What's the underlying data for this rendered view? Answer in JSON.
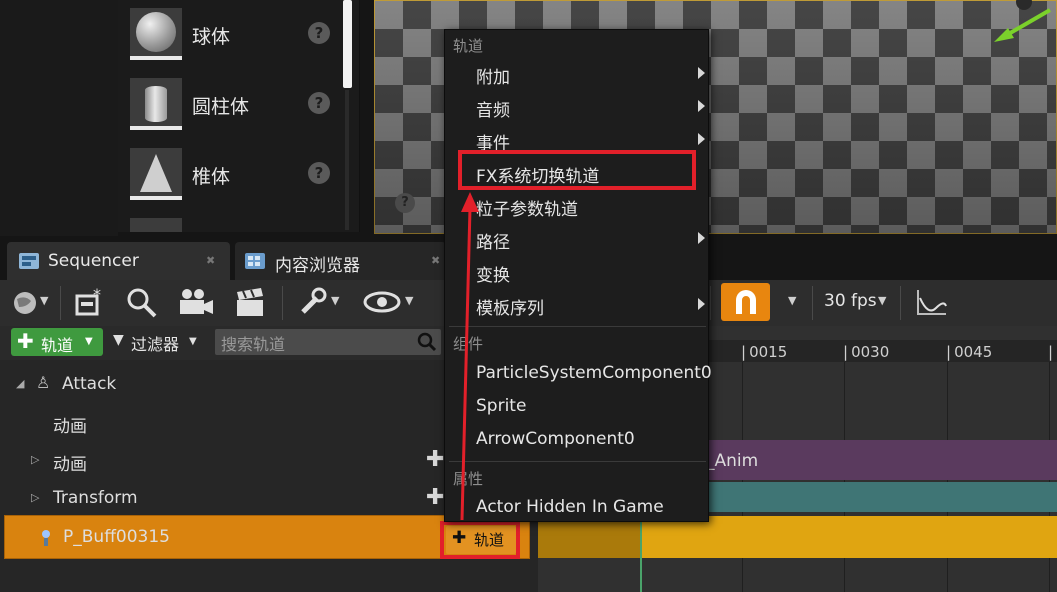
{
  "place_panel": {
    "items": [
      {
        "label": "球体",
        "icon": "sphere-icon"
      },
      {
        "label": "圆柱体",
        "icon": "cylinder-icon"
      },
      {
        "label": "椎体",
        "icon": "cone-icon"
      }
    ],
    "help_glyph": "?"
  },
  "tabs": [
    {
      "label": "Sequencer",
      "icon": "sequencer-icon",
      "active": true
    },
    {
      "label": "内容浏览器",
      "icon": "content-browser-icon",
      "active": false
    }
  ],
  "toolbar": {
    "fps": "30 fps"
  },
  "filter_row": {
    "add_track_label": "轨道",
    "filter_label": "过滤器",
    "search_placeholder": "搜索轨道"
  },
  "outliner": {
    "rows": [
      {
        "label": "Attack"
      },
      {
        "label": "动画"
      },
      {
        "label": "动画"
      },
      {
        "label": "Transform"
      },
      {
        "label": "P_Buff00315"
      }
    ],
    "track_button_label": "轨道"
  },
  "timeline": {
    "ticks": [
      "0015",
      "0030",
      "0045"
    ],
    "anim_bar_label": "_Anim"
  },
  "context_menu": {
    "sections": {
      "tracks": "轨道",
      "components": "组件",
      "properties": "属性"
    },
    "track_items": [
      "附加",
      "音频",
      "事件",
      "FX系统切换轨道",
      "粒子参数轨道",
      "路径",
      "变换",
      "模板序列"
    ],
    "component_items": [
      "ParticleSystemComponent0",
      "Sprite",
      "ArrowComponent0"
    ],
    "property_items": [
      "Actor Hidden In Game"
    ]
  },
  "colors": {
    "accent_orange": "#e8860f",
    "highlight_red": "#e2202a",
    "add_green": "#3f9a3f"
  }
}
